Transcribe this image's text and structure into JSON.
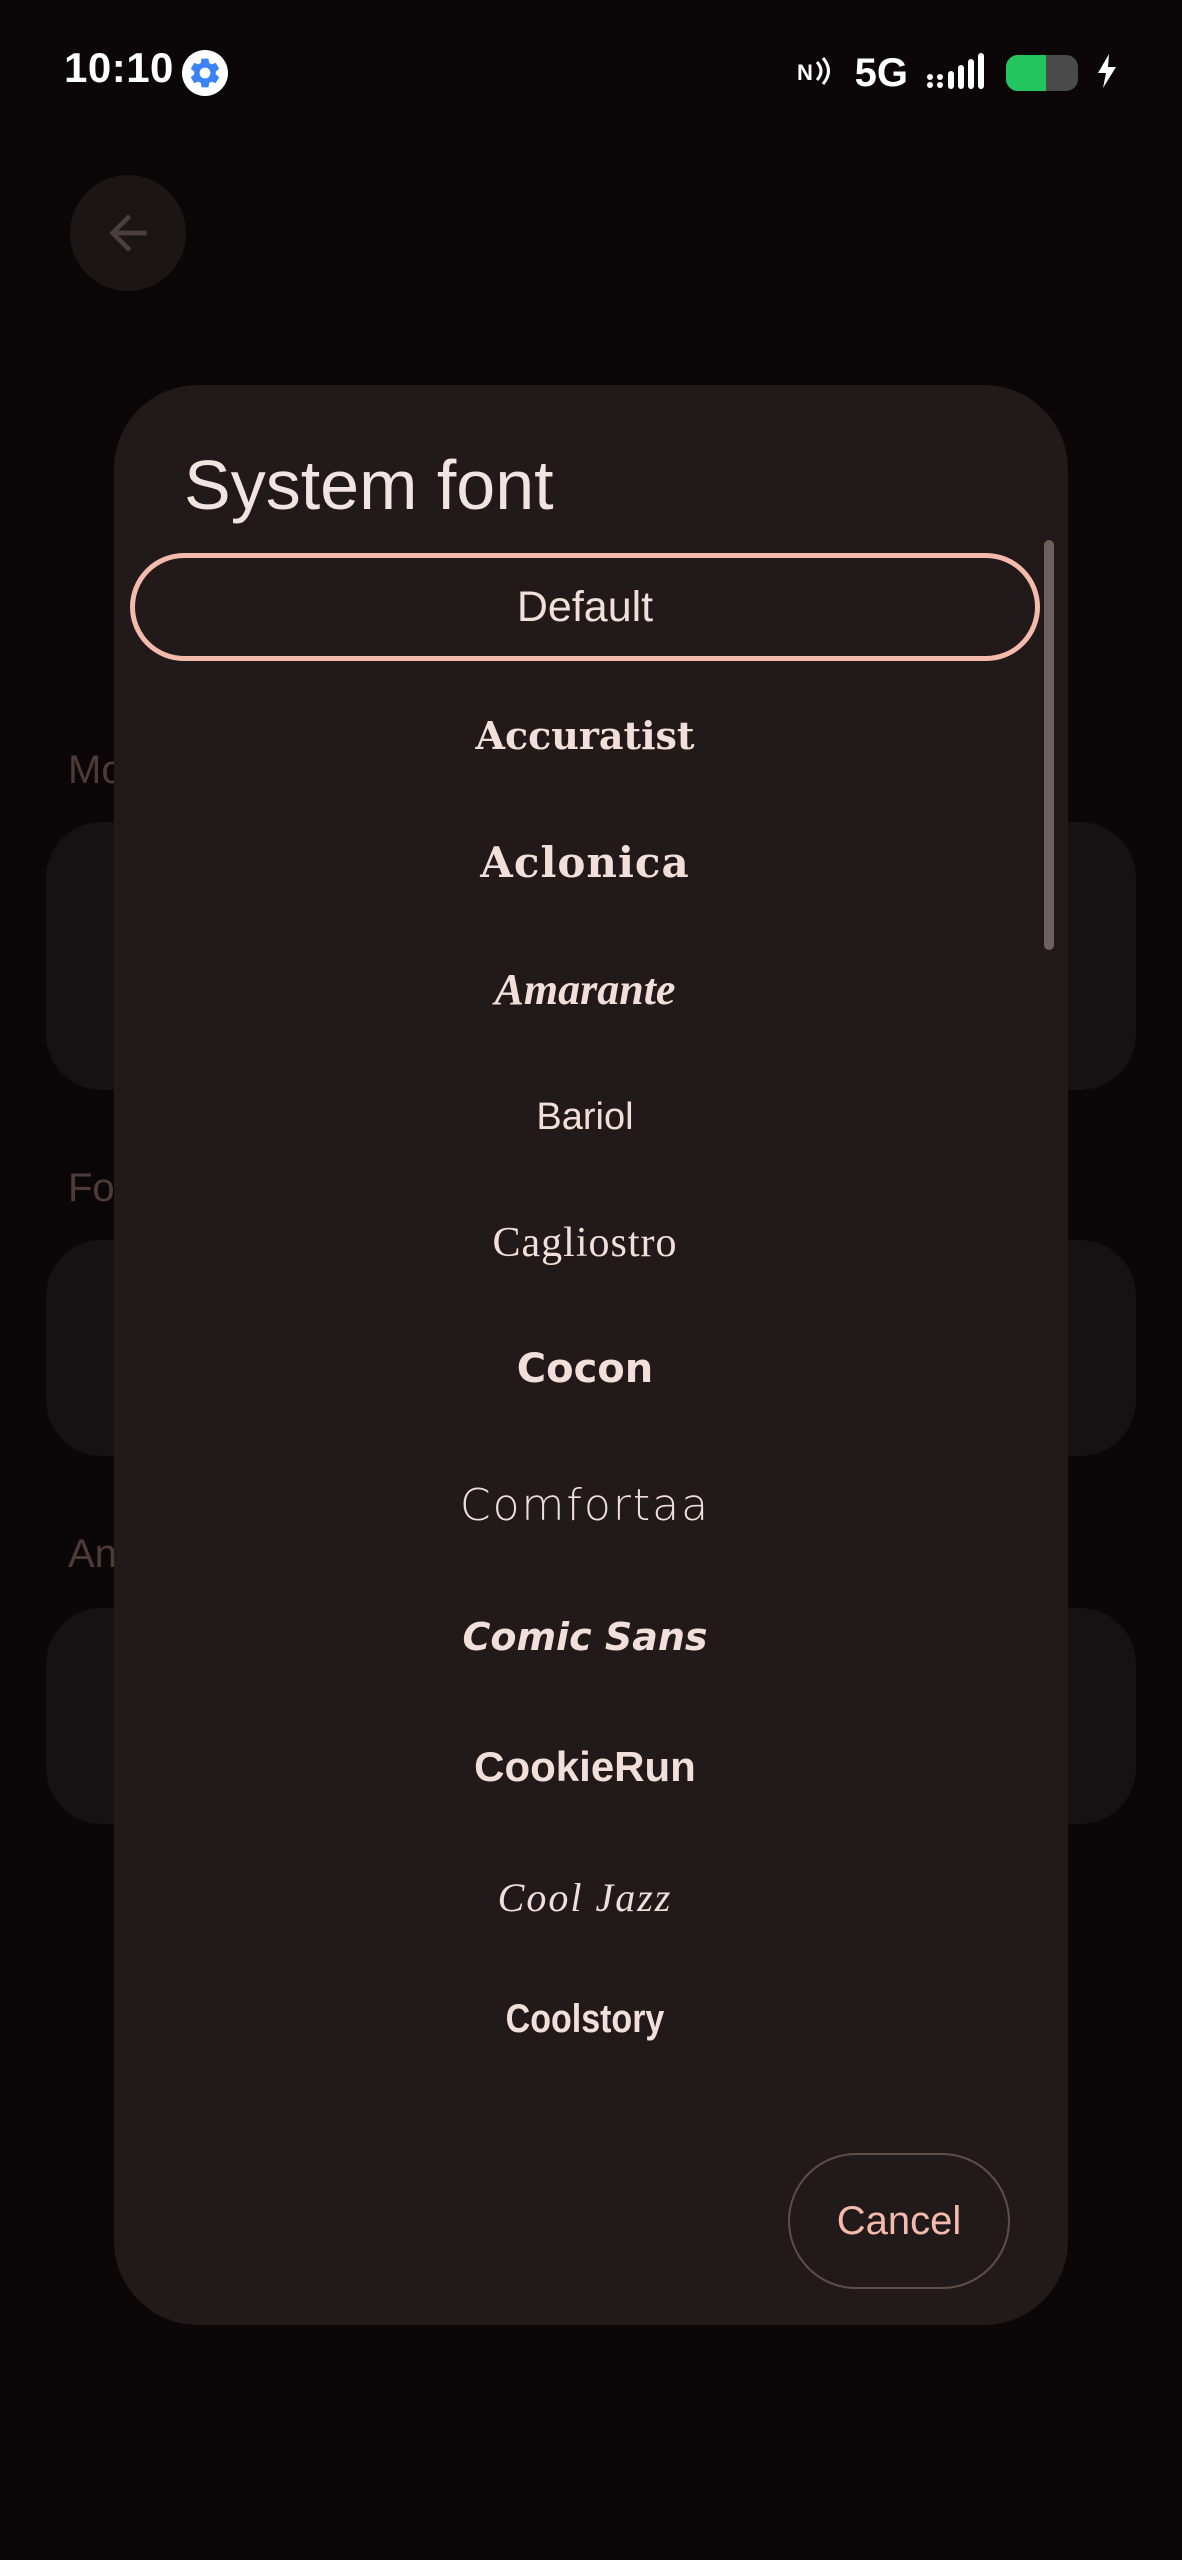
{
  "status_bar": {
    "time": "10:10",
    "settings_icon": "gear-icon",
    "nfc_icon": "nfc-icon",
    "network_type": "5G",
    "signal_icon": "signal-icon",
    "battery_level": 0.55,
    "battery_color": "#22c55e",
    "charging_icon": "bolt-icon"
  },
  "background": {
    "back_icon": "arrow-left-icon",
    "section_labels": [
      "Mo",
      "Fo",
      "An"
    ]
  },
  "dialog": {
    "title": "System font",
    "fonts": [
      {
        "label": "Default",
        "selected": true
      },
      {
        "label": "Accuratist",
        "selected": false
      },
      {
        "label": "Aclonica",
        "selected": false
      },
      {
        "label": "Amarante",
        "selected": false
      },
      {
        "label": "Bariol",
        "selected": false
      },
      {
        "label": "Cagliostro",
        "selected": false
      },
      {
        "label": "Cocon",
        "selected": false
      },
      {
        "label": "Comfortaa",
        "selected": false
      },
      {
        "label": "Comic Sans",
        "selected": false
      },
      {
        "label": "CookieRun",
        "selected": false
      },
      {
        "label": "Cool Jazz",
        "selected": false
      },
      {
        "label": "Coolstory",
        "selected": false
      }
    ],
    "cancel_label": "Cancel",
    "accent_color": "#f4bbac"
  }
}
